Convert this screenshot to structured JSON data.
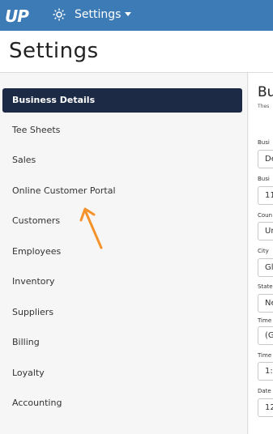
{
  "app": {
    "logo_text": "UP",
    "settings_menu_label": "Settings"
  },
  "page": {
    "title": "Settings"
  },
  "sidebar": {
    "items": [
      {
        "label": "Business Details",
        "active": true
      },
      {
        "label": "Tee Sheets",
        "active": false
      },
      {
        "label": "Sales",
        "active": false
      },
      {
        "label": "Online Customer Portal",
        "active": false
      },
      {
        "label": "Customers",
        "active": false
      },
      {
        "label": "Employees",
        "active": false
      },
      {
        "label": "Inventory",
        "active": false
      },
      {
        "label": "Suppliers",
        "active": false
      },
      {
        "label": "Billing",
        "active": false
      },
      {
        "label": "Loyalty",
        "active": false
      },
      {
        "label": "Accounting",
        "active": false
      }
    ]
  },
  "main": {
    "section_title": "Bu",
    "section_desc": "Thes",
    "fields": [
      {
        "label": "Busi",
        "value": "De"
      },
      {
        "label": "Busi",
        "value": "11"
      },
      {
        "label": "Coun",
        "value": "Un"
      },
      {
        "label": "City",
        "value": "Gl"
      },
      {
        "label": "State",
        "value": "Ne"
      },
      {
        "label": "Time",
        "value": "(G"
      },
      {
        "label": "Time",
        "value": "1:0"
      },
      {
        "label": "Date",
        "value": "12"
      }
    ]
  },
  "colors": {
    "topbar": "#3d7bb6",
    "active_nav": "#1c2a45",
    "arrow": "#f5922a"
  },
  "icons": {
    "gear": "gear-icon",
    "caret": "chevron-down-icon",
    "arrow": "annotation-arrow"
  }
}
